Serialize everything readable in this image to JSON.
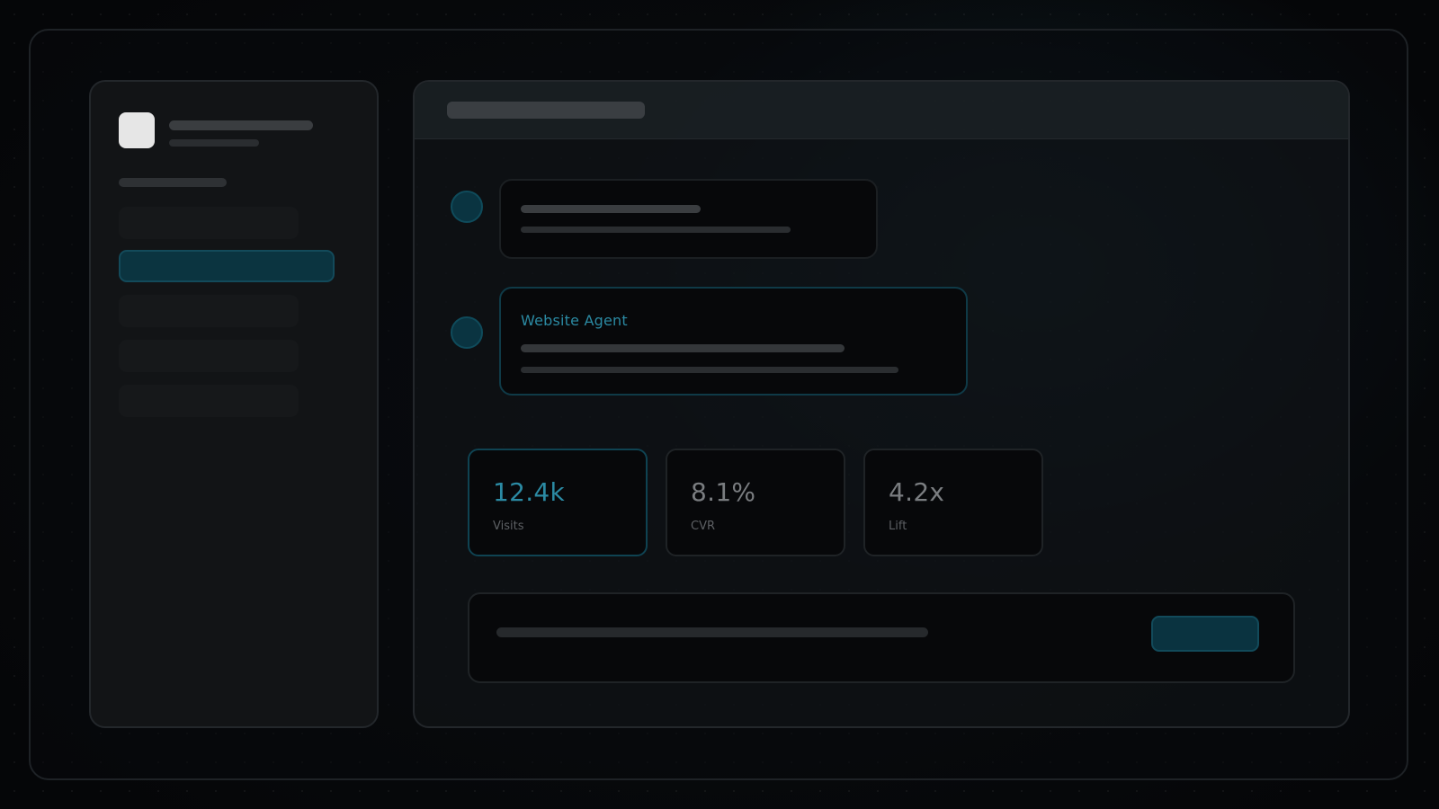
{
  "conversation": {
    "agent_message": {
      "sender": "Website Agent"
    }
  },
  "stats": [
    {
      "value": "12.4k",
      "label": "Visits",
      "highlight": true
    },
    {
      "value": "8.1%",
      "label": "CVR",
      "highlight": false
    },
    {
      "value": "4.2x",
      "label": "Lift",
      "highlight": false
    }
  ],
  "colors": {
    "accent": "#2b8aa3",
    "accent_dark": "#0b3440",
    "surface": "#07080a",
    "background": "#050608"
  },
  "icons": {
    "logo": "app-logo",
    "user_avatar": "user-avatar",
    "agent_avatar": "agent-avatar"
  }
}
